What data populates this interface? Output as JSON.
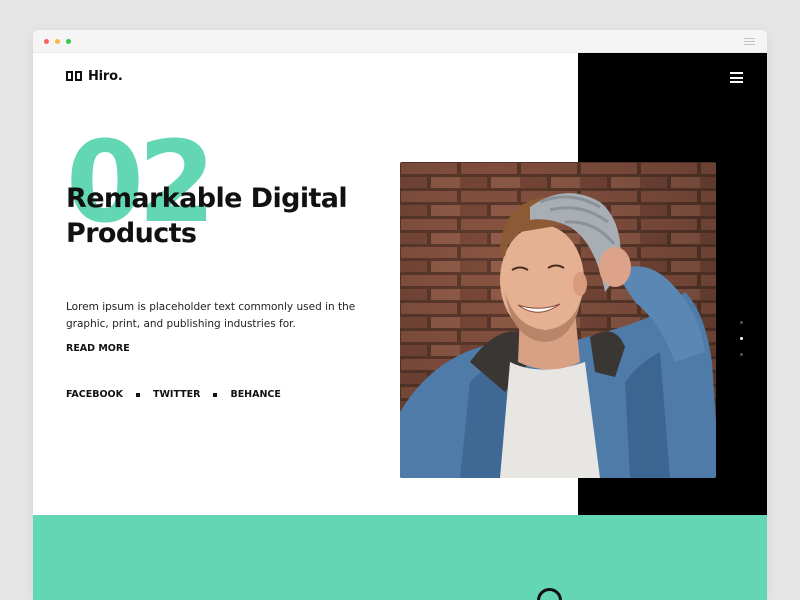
{
  "brand": {
    "name": "Hiro."
  },
  "hero": {
    "slide_number": "02",
    "headline_line1": "Remarkable Digital",
    "headline_line2": "Products",
    "description": "Lorem ipsum is placeholder text commonly used in the graphic, print, and publishing industries for.",
    "read_more_label": "READ MORE"
  },
  "social": [
    {
      "label": "FACEBOOK"
    },
    {
      "label": "TWITTER"
    },
    {
      "label": "BEHANCE"
    }
  ],
  "slider": {
    "total_slides": 3,
    "active_index": 1
  },
  "colors": {
    "accent": "#63d7b4",
    "dark_panel": "#000000",
    "text": "#111111",
    "dot_active": "#ffffff",
    "dot_inactive": "#555555"
  },
  "icons": {
    "menu": "hamburger-icon",
    "logo": "logo-mark-icon",
    "scroll": "circle-icon"
  }
}
